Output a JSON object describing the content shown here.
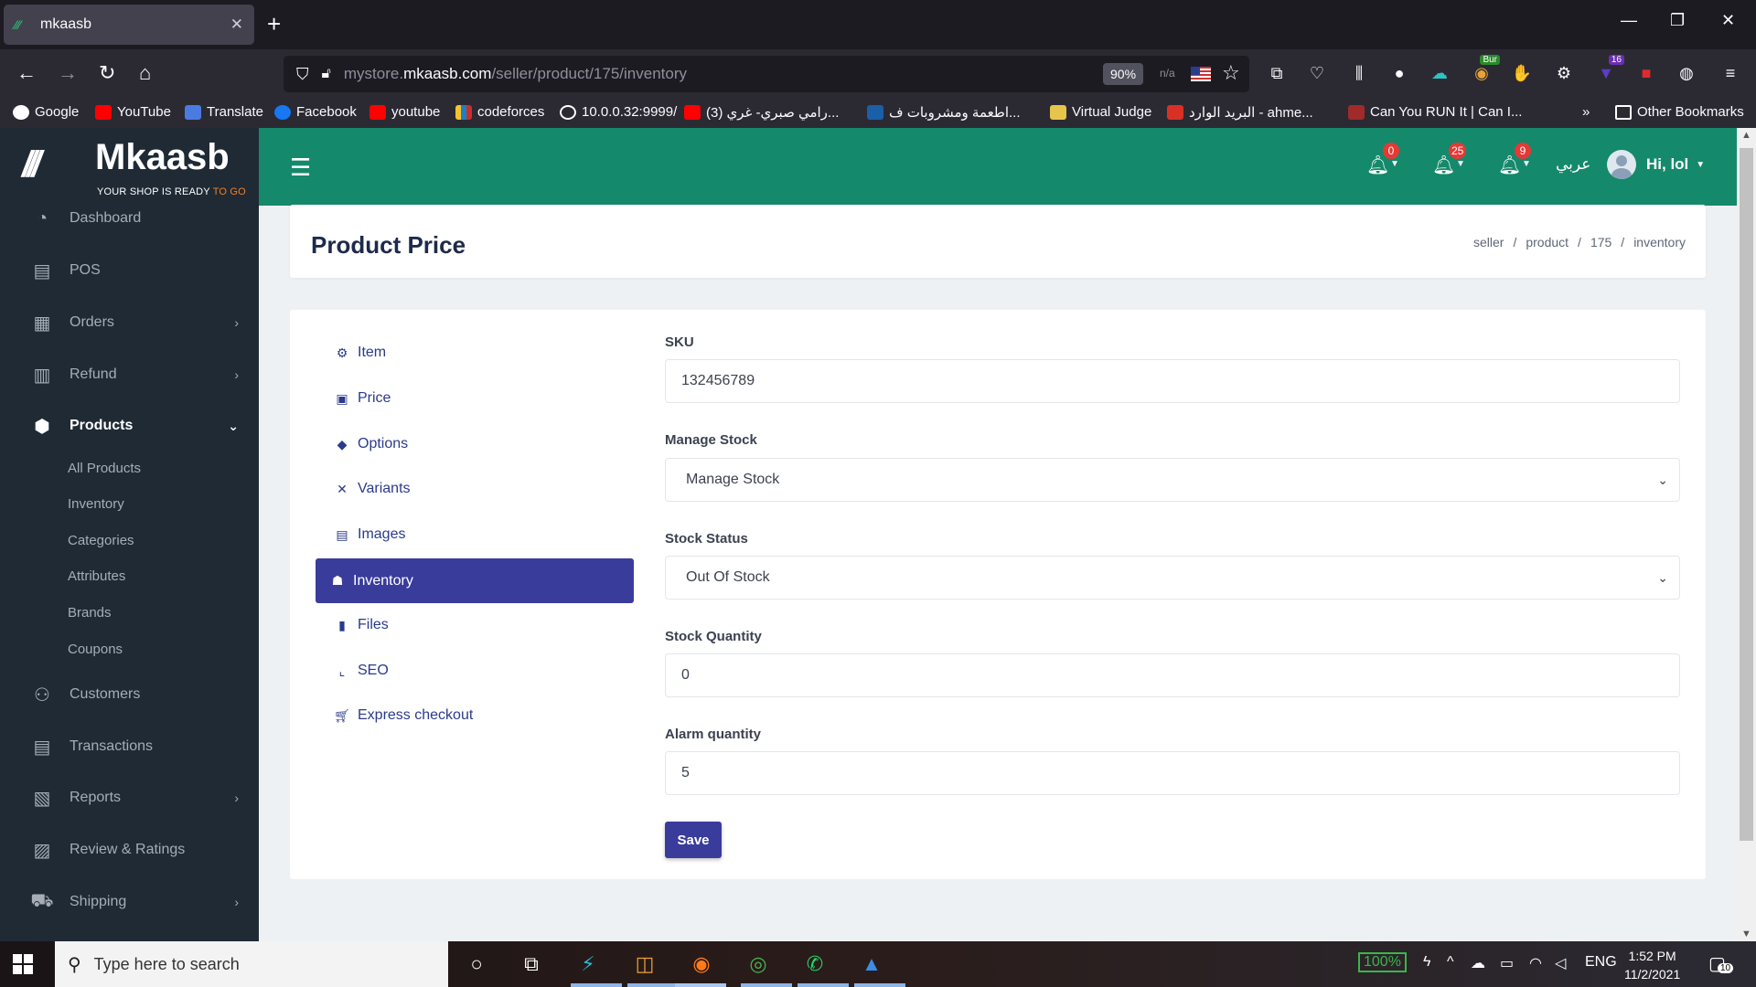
{
  "browser": {
    "tab_title": "mkaasb",
    "url_prefix": "mystore.",
    "url_domain": "mkaasb.com",
    "url_path": "/seller/product/175/inventory",
    "zoom": "90%",
    "na_label": "n/a",
    "ext_badge": "16",
    "ext_bur": "Bur",
    "bookmarks": [
      "Google",
      "YouTube",
      "Translate",
      "Facebook",
      "youtube",
      "codeforces",
      "10.0.0.32:9999/",
      "(3) رامي صبري- غري...",
      "اطعمة ومشروبات ف...",
      "Virtual Judge",
      "البريد الوارد - ahme...",
      "Can You RUN It | Can I..."
    ],
    "other_bookmarks": "Other Bookmarks"
  },
  "sidebar": {
    "logo_name": "Mkaasb",
    "logo_tag_main": "YOUR SHOP IS READY ",
    "logo_tag_accent": "TO GO",
    "items": [
      {
        "label": "Dashboard",
        "icon": "dashboard-icon"
      },
      {
        "label": "POS",
        "icon": "pos-icon"
      },
      {
        "label": "Orders",
        "icon": "orders-icon"
      },
      {
        "label": "Refund",
        "icon": "refund-icon"
      },
      {
        "label": "Products",
        "icon": "products-icon"
      },
      {
        "label": "Customers",
        "icon": "customers-icon"
      },
      {
        "label": "Transactions",
        "icon": "transactions-icon"
      },
      {
        "label": "Reports",
        "icon": "reports-icon"
      },
      {
        "label": "Review & Ratings",
        "icon": "review-icon"
      },
      {
        "label": "Shipping",
        "icon": "shipping-icon"
      }
    ],
    "product_subitems": [
      "All Products",
      "Inventory",
      "Categories",
      "Attributes",
      "Brands",
      "Coupons"
    ]
  },
  "topbar": {
    "notif_counts": [
      "0",
      "25",
      "9"
    ],
    "language": "عربي",
    "greeting": "Hi, lol"
  },
  "header": {
    "title": "Product Price",
    "breadcrumb": [
      "seller",
      "product",
      "175",
      "inventory"
    ]
  },
  "product_nav": [
    {
      "label": "Item",
      "icon": "cogs-icon"
    },
    {
      "label": "Price",
      "icon": "money-icon"
    },
    {
      "label": "Options",
      "icon": "tags-icon"
    },
    {
      "label": "Variants",
      "icon": "expand-icon"
    },
    {
      "label": "Images",
      "icon": "images-icon"
    },
    {
      "label": "Inventory",
      "icon": "cubes-icon"
    },
    {
      "label": "Files",
      "icon": "file-icon"
    },
    {
      "label": "SEO",
      "icon": "chart-icon"
    },
    {
      "label": "Express checkout",
      "icon": "cart-icon"
    }
  ],
  "form": {
    "sku_label": "SKU",
    "sku_value": "132456789",
    "manage_stock_label": "Manage Stock",
    "manage_stock_value": "Manage Stock",
    "stock_status_label": "Stock Status",
    "stock_status_value": "Out Of Stock",
    "stock_qty_label": "Stock Quantity",
    "stock_qty_value": "0",
    "alarm_qty_label": "Alarm quantity",
    "alarm_qty_value": "5",
    "save_label": "Save"
  },
  "taskbar": {
    "search_placeholder": "Type here to search",
    "battery": "100%",
    "lang": "ENG",
    "time": "1:52 PM",
    "date": "11/2/2021",
    "notif_count": "10"
  },
  "colors": {
    "topbar": "#15896b",
    "sidebar": "#1f2a35",
    "accent": "#3a3c9c",
    "badge": "#e53935"
  }
}
